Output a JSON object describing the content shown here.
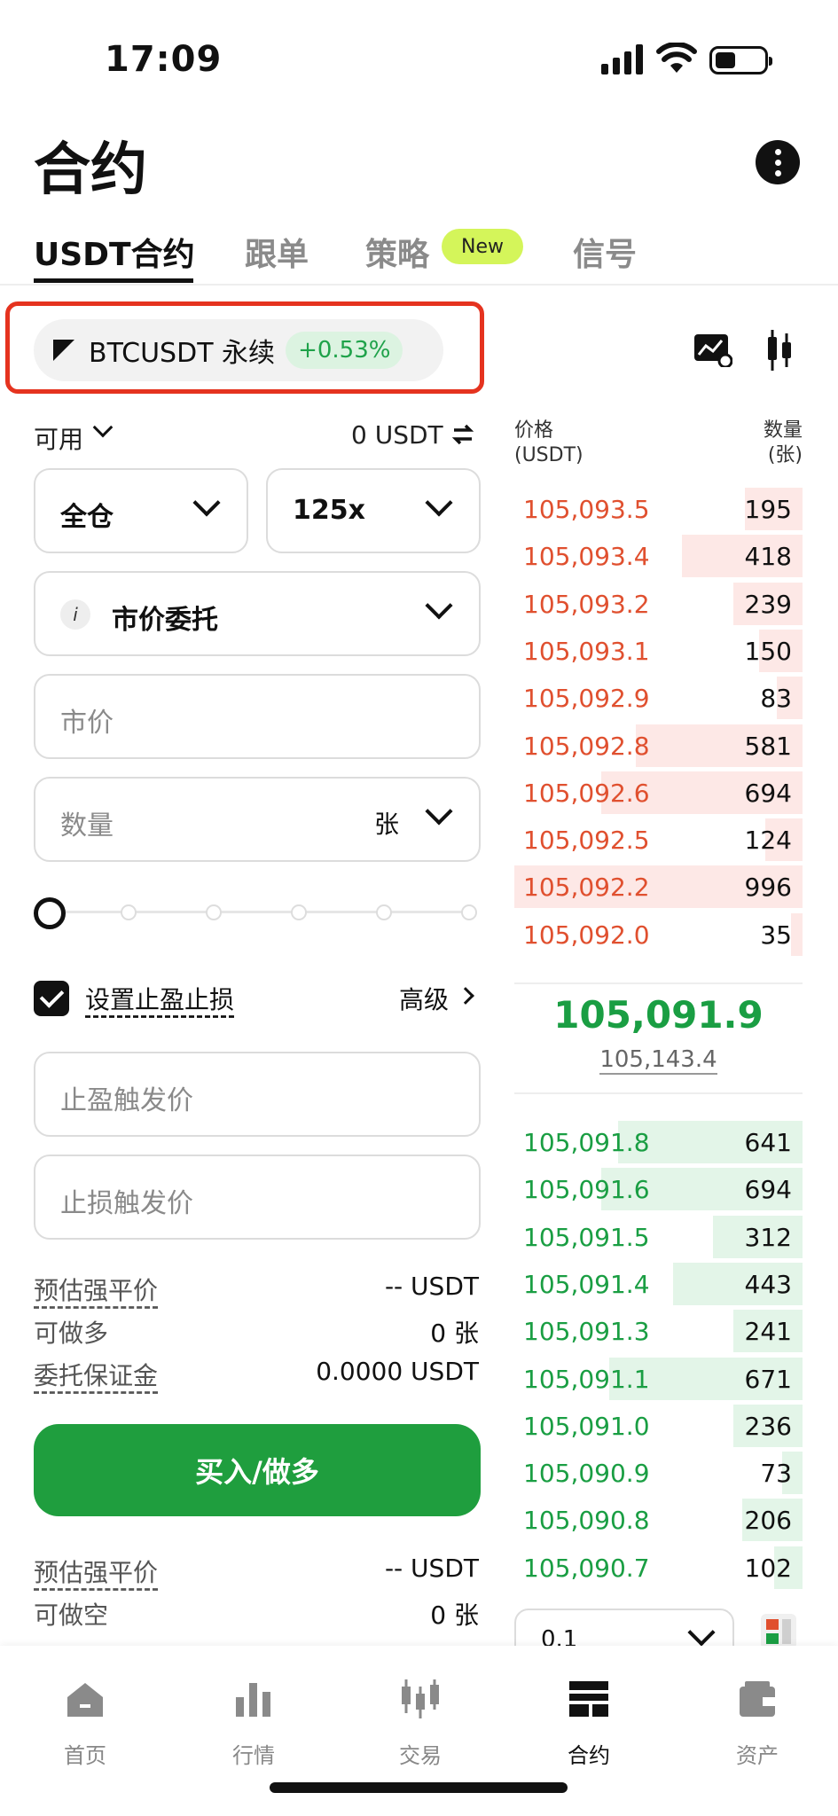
{
  "status_bar": {
    "time": "17:09"
  },
  "header": {
    "title": "合约"
  },
  "tabs": [
    {
      "label": "USDT合约",
      "active": true
    },
    {
      "label": "跟单"
    },
    {
      "label": "策略",
      "badge": "New"
    },
    {
      "label": "信号"
    }
  ],
  "symbol": {
    "name": "BTCUSDT 永续",
    "change": "+0.53%"
  },
  "form": {
    "available_label": "可用",
    "available_value": "0 USDT",
    "margin_mode": "全仓",
    "leverage": "125x",
    "order_type": "市价委托",
    "price_placeholder": "市价",
    "quantity_placeholder": "数量",
    "quantity_unit": "张",
    "tpsl_label": "设置止盈止损",
    "advanced_label": "高级",
    "tp_placeholder": "止盈触发价",
    "sl_placeholder": "止损触发价",
    "long_info": [
      {
        "label": "预估强平价",
        "value": "-- USDT"
      },
      {
        "label": "可做多",
        "value": "0 张"
      },
      {
        "label": "委托保证金",
        "value": "0.0000 USDT"
      }
    ],
    "buy_button": "买入/做多",
    "short_info": [
      {
        "label": "预估强平价",
        "value": "-- USDT"
      },
      {
        "label": "可做空",
        "value": "0 张"
      }
    ]
  },
  "orderbook": {
    "price_header": "价格",
    "price_unit": "(USDT)",
    "qty_header": "数量",
    "qty_unit": "(张)",
    "asks": [
      {
        "price": "105,093.5",
        "qty": "195",
        "depth": 0.2
      },
      {
        "price": "105,093.4",
        "qty": "418",
        "depth": 0.42
      },
      {
        "price": "105,093.2",
        "qty": "239",
        "depth": 0.24
      },
      {
        "price": "105,093.1",
        "qty": "150",
        "depth": 0.15
      },
      {
        "price": "105,092.9",
        "qty": "83",
        "depth": 0.09
      },
      {
        "price": "105,092.8",
        "qty": "581",
        "depth": 0.58
      },
      {
        "price": "105,092.6",
        "qty": "694",
        "depth": 0.7
      },
      {
        "price": "105,092.5",
        "qty": "124",
        "depth": 0.13
      },
      {
        "price": "105,092.2",
        "qty": "996",
        "depth": 1.0
      },
      {
        "price": "105,092.0",
        "qty": "35",
        "depth": 0.04
      }
    ],
    "last_price": "105,091.9",
    "mark_price": "105,143.4",
    "bids": [
      {
        "price": "105,091.8",
        "qty": "641",
        "depth": 0.64
      },
      {
        "price": "105,091.6",
        "qty": "694",
        "depth": 0.7
      },
      {
        "price": "105,091.5",
        "qty": "312",
        "depth": 0.31
      },
      {
        "price": "105,091.4",
        "qty": "443",
        "depth": 0.45
      },
      {
        "price": "105,091.3",
        "qty": "241",
        "depth": 0.24
      },
      {
        "price": "105,091.1",
        "qty": "671",
        "depth": 0.67
      },
      {
        "price": "105,091.0",
        "qty": "236",
        "depth": 0.24
      },
      {
        "price": "105,090.9",
        "qty": "73",
        "depth": 0.07
      },
      {
        "price": "105,090.8",
        "qty": "206",
        "depth": 0.21
      },
      {
        "price": "105,090.7",
        "qty": "102",
        "depth": 0.1
      }
    ],
    "precision": "0.1"
  },
  "nav": [
    {
      "label": "首页",
      "icon": "home-icon"
    },
    {
      "label": "行情",
      "icon": "market-icon"
    },
    {
      "label": "交易",
      "icon": "trade-icon"
    },
    {
      "label": "合约",
      "icon": "futures-icon",
      "active": true
    },
    {
      "label": "资产",
      "icon": "wallet-icon"
    }
  ],
  "colors": {
    "ask": "#e0502f",
    "bid": "#1a9e43",
    "buy": "#1f9e3e",
    "badge": "#d4f55a",
    "highlight": "#e5331f"
  }
}
